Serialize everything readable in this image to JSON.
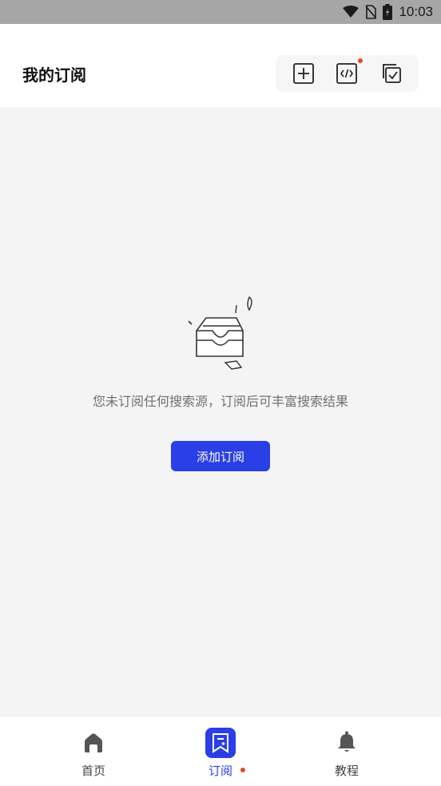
{
  "status_bar": {
    "time": "10:03"
  },
  "header": {
    "title": "我的订阅"
  },
  "toolbar": {
    "add_icon": "plus-square-icon",
    "code_icon": "code-icon",
    "check_icon": "copy-check-icon"
  },
  "empty_state": {
    "illustration": "empty-inbox-illustration",
    "message": "您未订阅任何搜索源，订阅后可丰富搜索结果",
    "button_label": "添加订阅"
  },
  "tabbar": {
    "tabs": [
      {
        "label": "首页",
        "icon": "home-icon"
      },
      {
        "label": "订阅",
        "icon": "bookmark-icon"
      },
      {
        "label": "教程",
        "icon": "bell-icon"
      }
    ],
    "active_color": "#2a3fe6",
    "badge_color": "#e8462b"
  },
  "colors": {
    "accent": "#2a3fe6",
    "badge": "#e8462b",
    "background": "#f4f4f4"
  }
}
